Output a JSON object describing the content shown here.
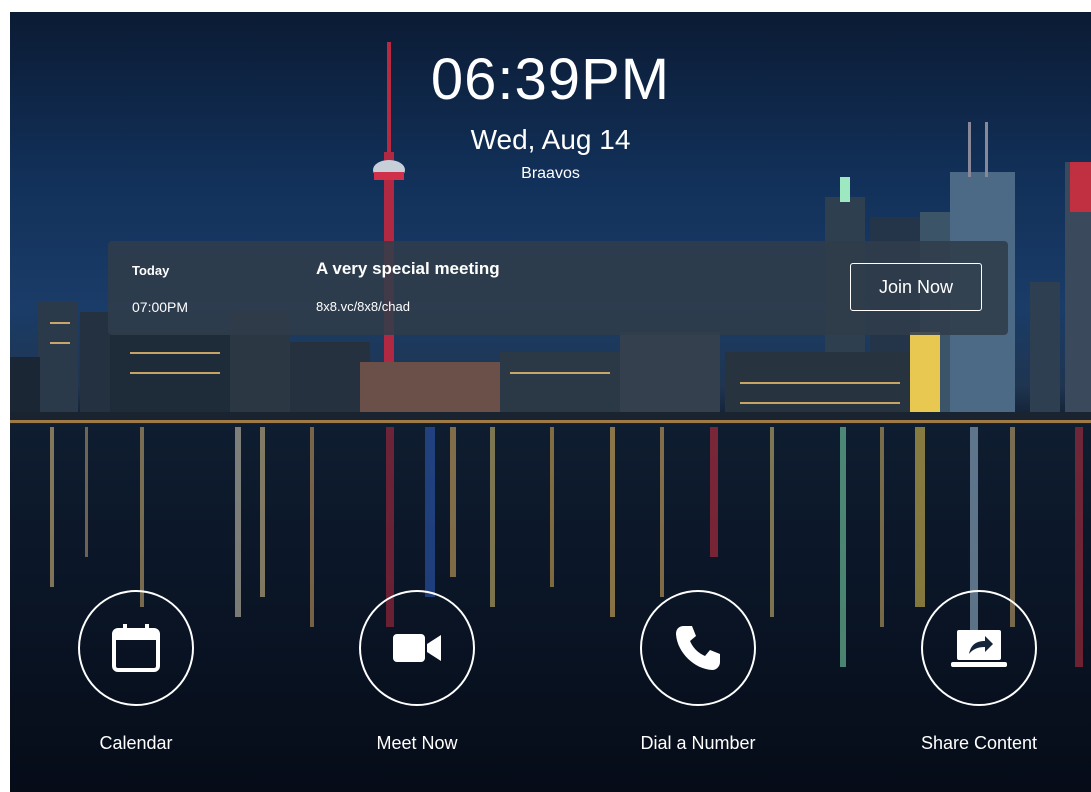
{
  "clock": {
    "time": "06:39PM",
    "date": "Wed, Aug 14",
    "location": "Braavos"
  },
  "meeting": {
    "day": "Today",
    "time": "07:00PM",
    "title": "A very special meeting",
    "link": "8x8.vc/8x8/chad",
    "join_label": "Join Now"
  },
  "actions": [
    {
      "label": "Calendar",
      "icon": "calendar-icon"
    },
    {
      "label": "Meet Now",
      "icon": "video-camera-icon"
    },
    {
      "label": "Dial a Number",
      "icon": "phone-icon"
    },
    {
      "label": "Share Content",
      "icon": "share-screen-icon"
    }
  ],
  "colors": {
    "text": "#ffffff",
    "card_bg": "#303c4a",
    "tower_red": "#d0304a"
  }
}
